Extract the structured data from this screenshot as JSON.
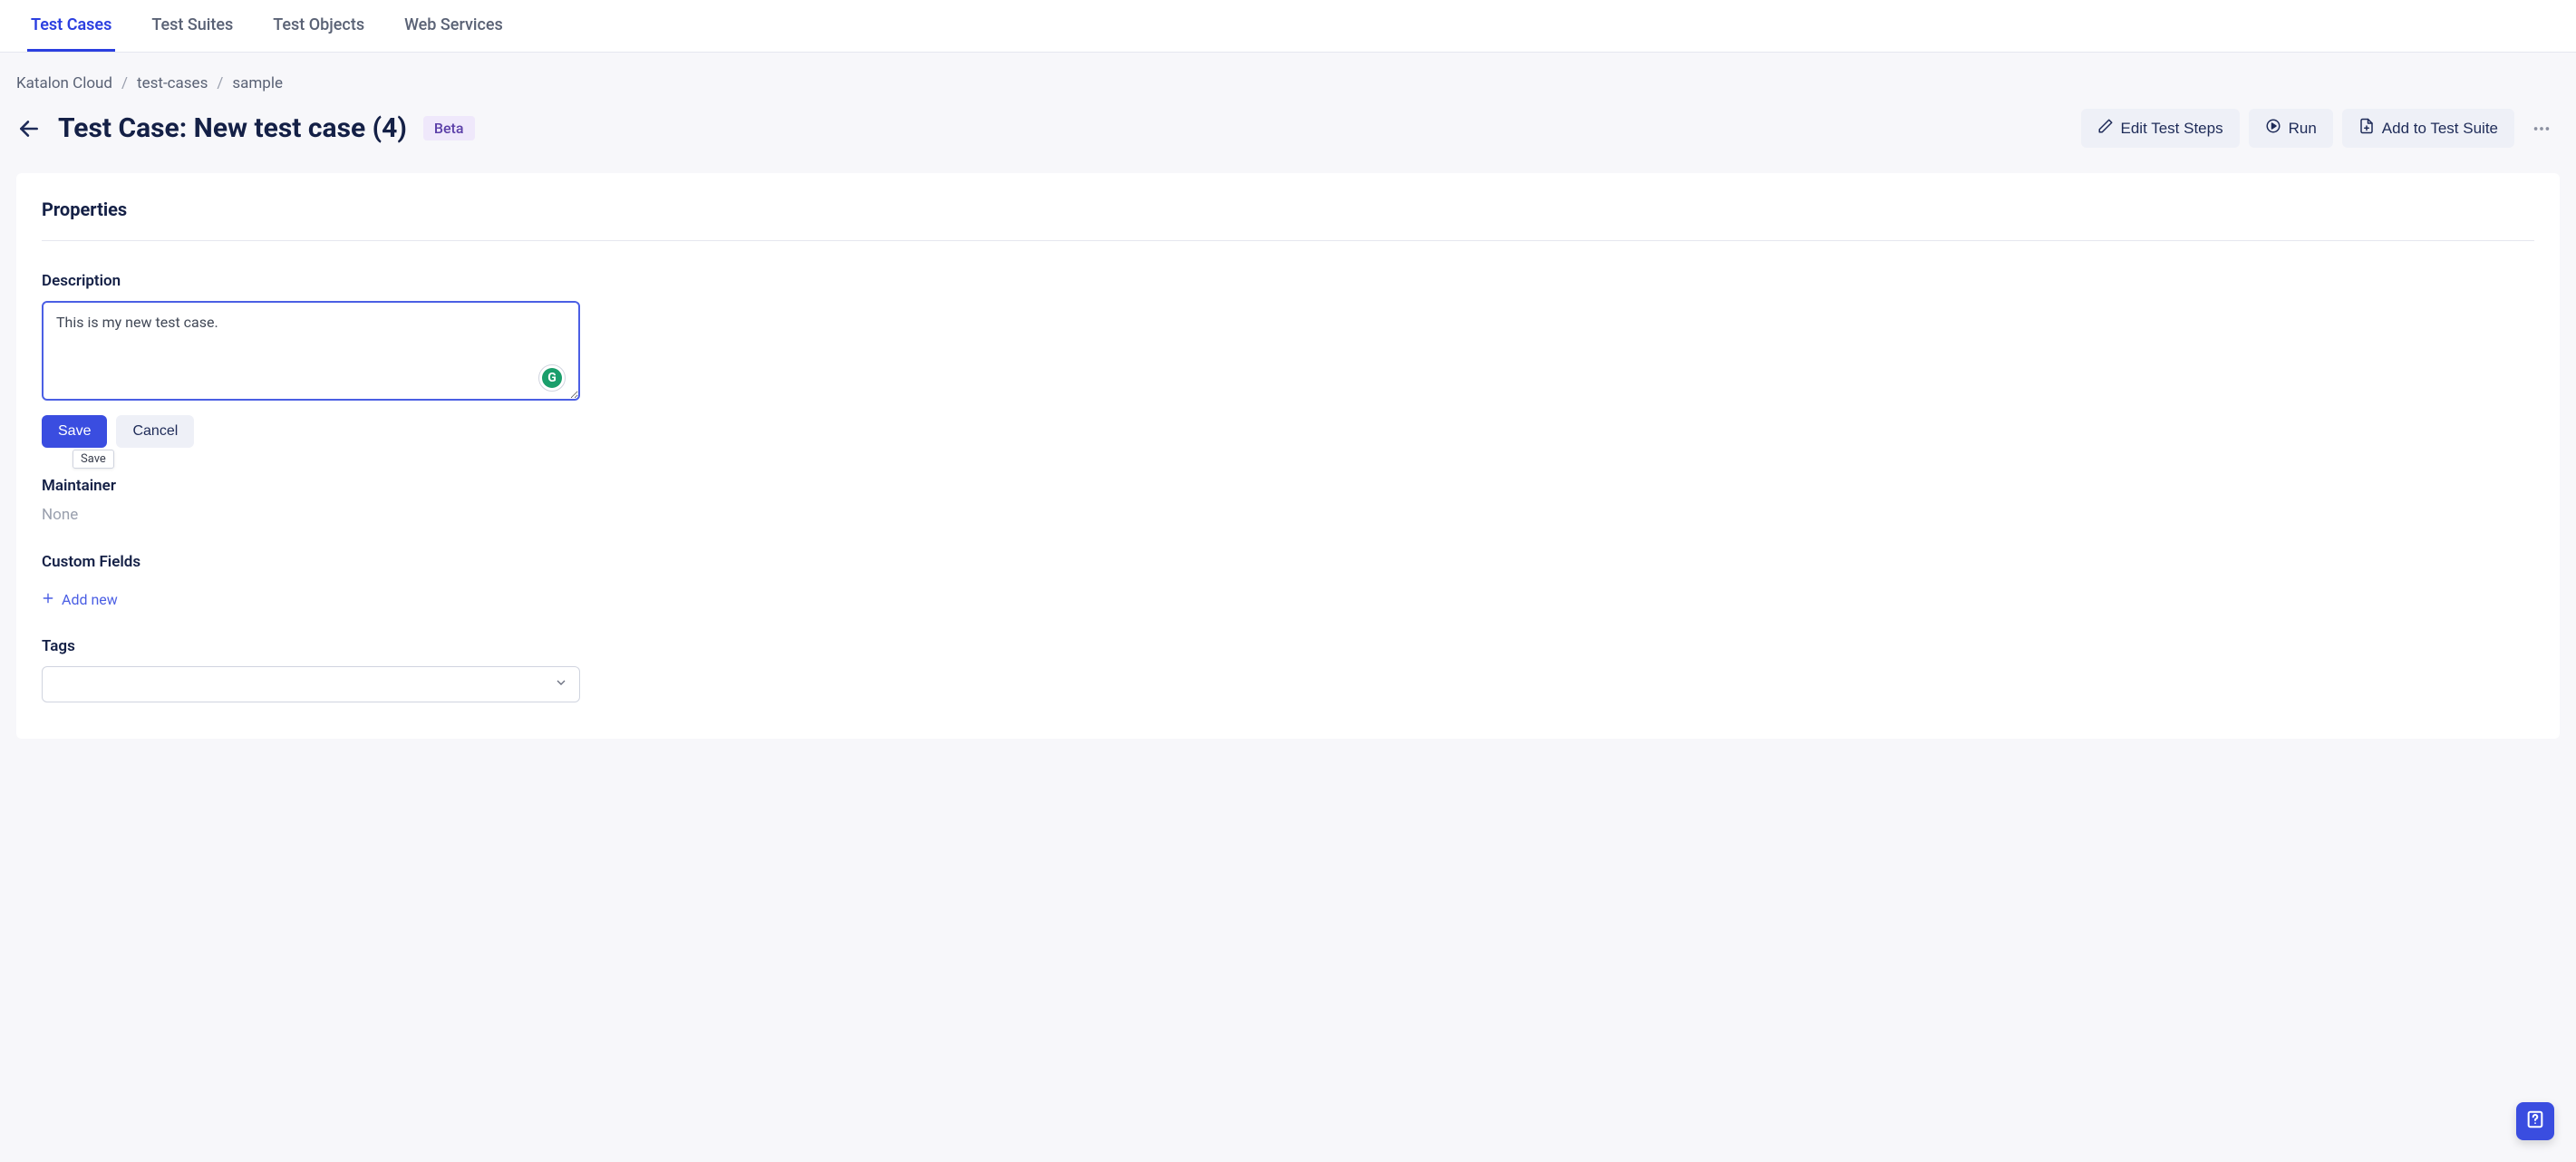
{
  "nav": {
    "tabs": [
      "Test Cases",
      "Test Suites",
      "Test Objects",
      "Web Services"
    ],
    "active": 0
  },
  "breadcrumb": [
    "Katalon Cloud",
    "test-cases",
    "sample"
  ],
  "header": {
    "title": "Test Case: New test case (4)",
    "badge": "Beta",
    "actions": {
      "edit": "Edit Test Steps",
      "run": "Run",
      "add_suite": "Add to Test Suite"
    }
  },
  "panel": {
    "title": "Properties",
    "description": {
      "label": "Description",
      "value": "This is my new test case."
    },
    "buttons": {
      "save": "Save",
      "cancel": "Cancel",
      "save_tooltip": "Save"
    },
    "maintainer": {
      "label": "Maintainer",
      "value": "None"
    },
    "custom_fields": {
      "label": "Custom Fields",
      "add_new": "Add new"
    },
    "tags": {
      "label": "Tags",
      "placeholder": ""
    }
  },
  "grammarly_letter": "G"
}
